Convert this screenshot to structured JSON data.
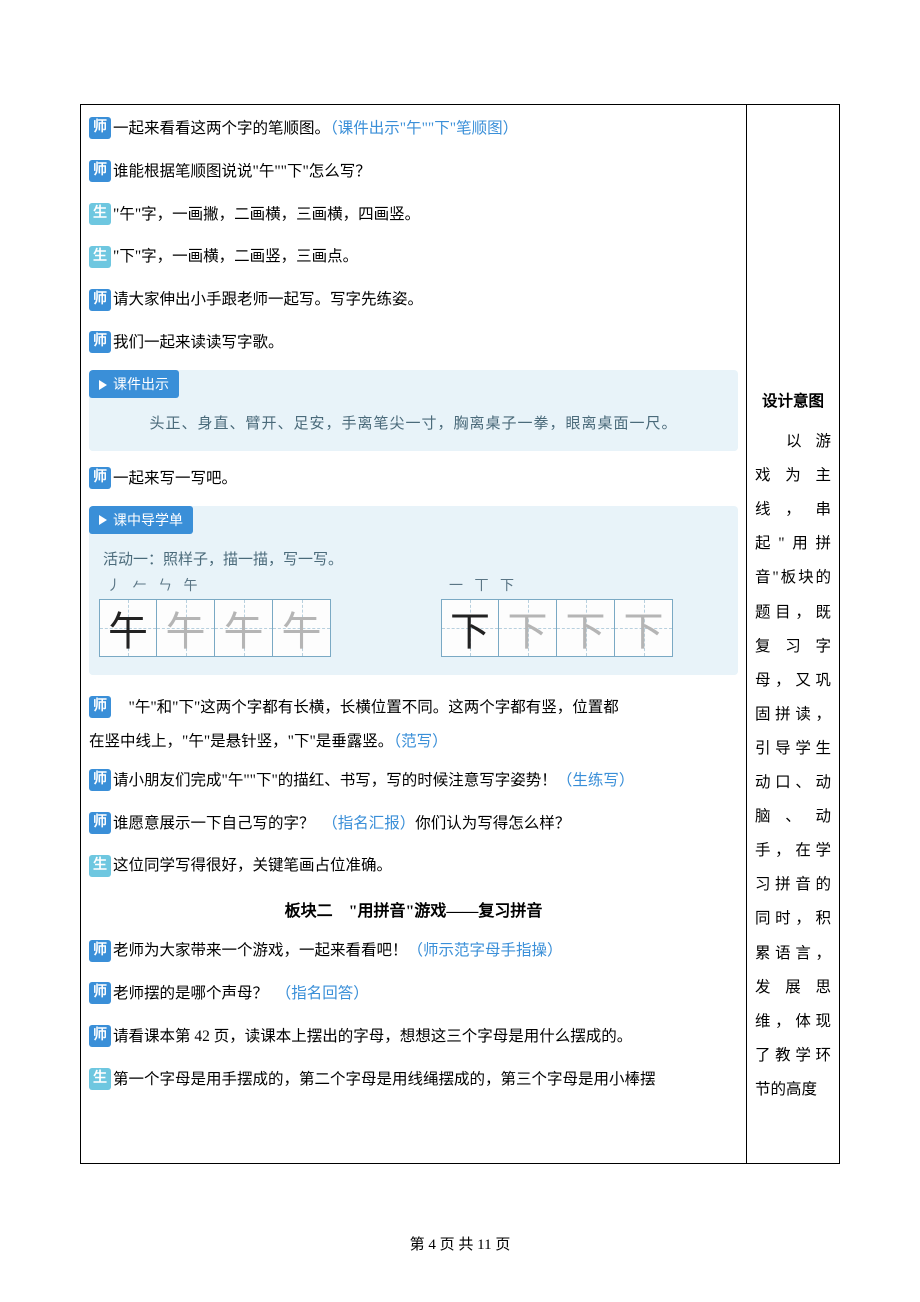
{
  "tags": {
    "teacher": "师",
    "student": "生"
  },
  "lines": {
    "l1": "一起来看看这两个字的笔顺图。",
    "l1_note": "（课件出示\"午\"\"下\"笔顺图）",
    "l2": "谁能根据笔顺图说说\"午\"\"下\"怎么写？",
    "l3": "\"午\"字，一画撇，二画横，三画横，四画竖。",
    "l4": "\"下\"字，一画横，二画竖，三画点。",
    "l5": "请大家伸出小手跟老师一起写。写字先练姿。",
    "l6": "我们一起来读读写字歌。",
    "l7": "一起来写一写吧。"
  },
  "panel1": {
    "head": "课件出示",
    "body": "头正、身直、臂开、足安，手离笔尖一寸，胸离桌子一拳，眼离桌面一尺。"
  },
  "panel2": {
    "head": "课中导学单",
    "activity": "活动一：照样子，描一描，写一写。",
    "hint_wu_strokes": "丿 𠂉 ㄣ 午",
    "hint_xia_strokes": "一 丅 下",
    "char_wu": "午",
    "char_xia": "下"
  },
  "para1": {
    "text_a": "　\"午\"和\"下\"这两个字都有长横，长横位置不同。这两个字都有竖，位置都",
    "text_b": "在竖中线上，\"午\"是悬针竖，\"下\"是垂露竖。",
    "note": "（范写）"
  },
  "para2": {
    "text": "请小朋友们完成\"午\"\"下\"的描红、书写，写的时候注意写字姿势！",
    "note": "（生练写）"
  },
  "para3": {
    "text_a": "谁愿意展示一下自己写的字？　",
    "note": "（指名汇报）",
    "text_b": "你们认为写得怎么样？"
  },
  "para4": {
    "text": "这位同学写得很好，关键笔画占位准确。"
  },
  "section2_title": "板块二　\"用拼音\"游戏——复习拼音",
  "para5": {
    "text": "老师为大家带来一个游戏，一起来看看吧！",
    "note": "（师示范字母手指操）"
  },
  "para6": {
    "text": "老师摆的是哪个声母？　",
    "note": "（指名回答）"
  },
  "para7": {
    "text": "请看课本第 42 页，读课本上摆出的字母，想想这三个字母是用什么摆成的。"
  },
  "para8": {
    "text": "第一个字母是用手摆成的，第二个字母是用线绳摆成的，第三个字母是用小棒摆"
  },
  "sidebar": {
    "title": "设计意图",
    "body": "以游戏为主线，串起\"用拼音\"板块的题目，既复习字母，又巩固拼读，引导学生动口、动脑、动手，在学习拼音的同时，积累语言，发展思维，体现了教学环节的高度"
  },
  "footer": {
    "prefix": "第 ",
    "current": "4",
    "middle": " 页 共 ",
    "total": "11",
    "suffix": " 页"
  }
}
